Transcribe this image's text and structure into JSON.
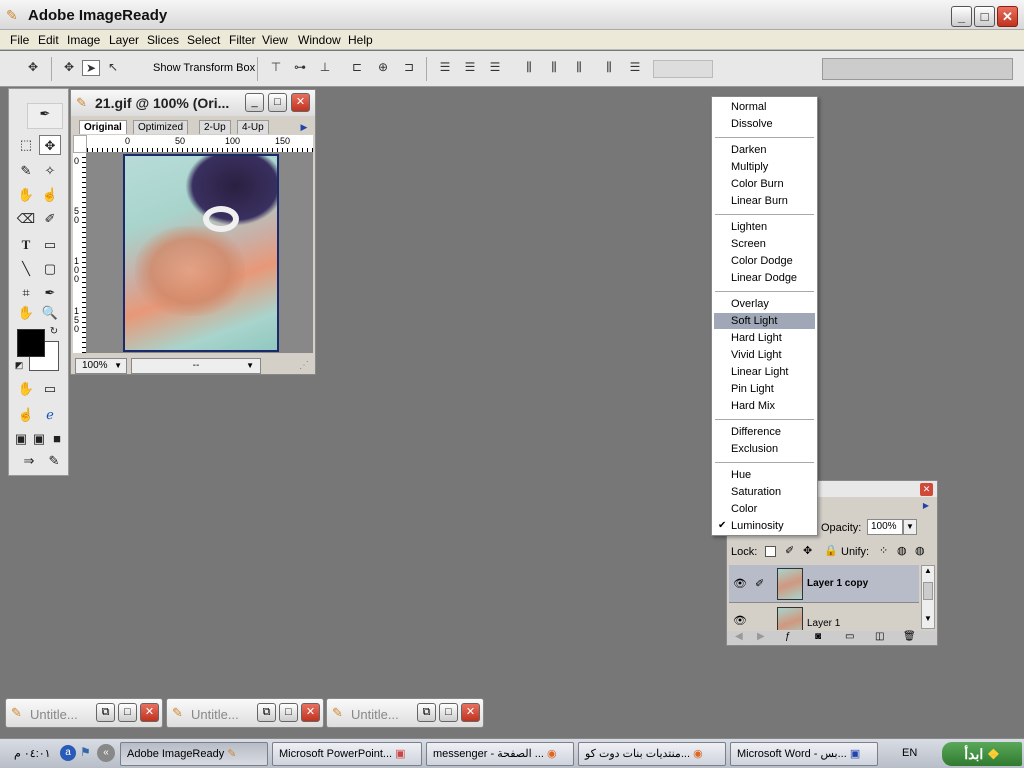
{
  "app": {
    "title": "Adobe ImageReady"
  },
  "menubar": {
    "items": [
      "File",
      "Edit",
      "Image",
      "Layer",
      "Slices",
      "Select",
      "Filter",
      "View",
      "Window",
      "Help"
    ]
  },
  "options": {
    "show_transform_box": "Show Transform Box"
  },
  "doc": {
    "title": "21.gif @ 100% (Ori...",
    "tabs": [
      "Original",
      "Optimized",
      "2-Up",
      "4-Up"
    ],
    "ruler_top": [
      "0",
      "50",
      "100",
      "150"
    ],
    "ruler_left": [
      "0",
      "5\n0",
      "1\n0\n0",
      "1\n5\n0"
    ],
    "zoom": "100%",
    "status": "--"
  },
  "blend_menu": {
    "groups": [
      [
        "Normal",
        "Dissolve"
      ],
      [
        "Darken",
        "Multiply",
        "Color Burn",
        "Linear Burn"
      ],
      [
        "Lighten",
        "Screen",
        "Color Dodge",
        "Linear Dodge"
      ],
      [
        "Overlay",
        "Soft Light",
        "Hard Light",
        "Vivid Light",
        "Linear Light",
        "Pin Light",
        "Hard Mix"
      ],
      [
        "Difference",
        "Exclusion"
      ],
      [
        "Hue",
        "Saturation",
        "Color",
        "Luminosity"
      ]
    ],
    "highlighted": "Soft Light",
    "checked": "Luminosity"
  },
  "layers": {
    "opacity_label": "Opacity:",
    "opacity_value": "100%",
    "lock_label": "Lock:",
    "unify_label": "Unify:",
    "rows": [
      "Layer 1 copy",
      "Layer 1"
    ]
  },
  "minimized": [
    {
      "label": "Untitle..."
    },
    {
      "label": "Untitle..."
    },
    {
      "label": "Untitle..."
    }
  ],
  "taskbar": {
    "start": "ابدأ",
    "clock": "٠٤:٠١ م",
    "lang": "EN",
    "tasks": [
      "Adobe ImageReady",
      "Microsoft PowerPoint...",
      "messenger - الصفحة ...",
      "منتديات بنات دوت كو...",
      "Microsoft Word - بس..."
    ]
  },
  "colors": {
    "workspace": "#777777",
    "selection": "#a0a8b8"
  }
}
